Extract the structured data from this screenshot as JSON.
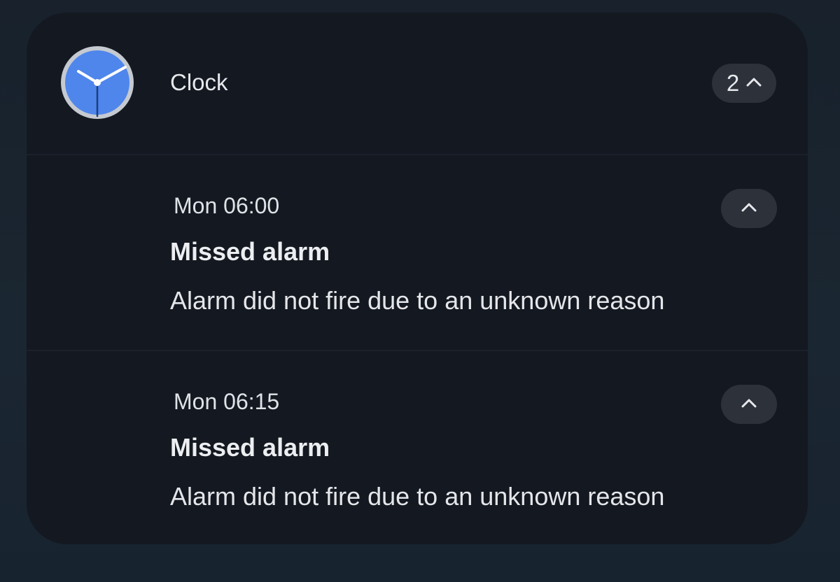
{
  "notification_group": {
    "app_name": "Clock",
    "app_icon": "clock-icon",
    "count": "2",
    "expand_icon": "chevron-up-icon",
    "colors": {
      "icon_face": "#4f86ec",
      "icon_rim": "#c5cad1",
      "card_background": "#141820",
      "pill_background": "#2c313a"
    }
  },
  "notifications": [
    {
      "time": "Mon 06:00",
      "title": "Missed alarm",
      "body": "Alarm did not fire due to an unknown reason",
      "button_icon": "chevron-up-icon"
    },
    {
      "time": "Mon 06:15",
      "title": "Missed alarm",
      "body": "Alarm did not fire due to an unknown reason",
      "button_icon": "chevron-up-icon"
    }
  ]
}
